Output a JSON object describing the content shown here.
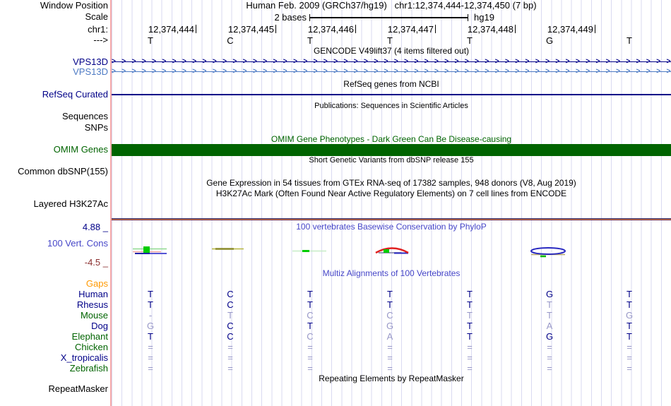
{
  "colors": {
    "navy": "#000088",
    "gene_blue": "#4d7ac4",
    "green": "#006400",
    "orange": "#ff9900",
    "title_blue": "#4646c8",
    "maroon": "#8b3030",
    "grid": "#dadaf2",
    "guide_pink": "#f5a9a9",
    "omim_green": "#006400",
    "base_dark": "#000088",
    "base_light": "#9898c8"
  },
  "header": {
    "title_left": "Human Feb. 2009 (GRCh37/hg19)",
    "title_right": "chr1:12,374,444-12,374,450 (7 bp)",
    "scale_bar": {
      "label": "2 bases",
      "assembly": "hg19"
    },
    "ruler": [
      "12,374,444",
      "12,374,445",
      "12,374,446",
      "12,374,447",
      "12,374,448",
      "12,374,449"
    ],
    "sequence": [
      "T",
      "C",
      "T",
      "T",
      "T",
      "G",
      "T"
    ]
  },
  "labels": {
    "window_position": "Window Position",
    "scale": "Scale",
    "chrom": "chr1:",
    "strand": "--->"
  },
  "tracks": {
    "gencode": {
      "title": "GENCODE V49lift37 (4 items filtered out)",
      "genes": [
        {
          "name": "VPS13D"
        },
        {
          "name": "VPS13D"
        }
      ]
    },
    "refseq": {
      "title": "RefSeq genes from NCBI",
      "label": "RefSeq Curated"
    },
    "publications": {
      "title": "Publications: Sequences in Scientific Articles"
    },
    "sequences": {
      "label": "Sequences"
    },
    "snps": {
      "label": "SNPs"
    },
    "omim": {
      "title": "OMIM Gene Phenotypes - Dark Green Can Be Disease-causing",
      "label": "OMIM Genes"
    },
    "dbsnp": {
      "title": "Short Genetic Variants from dbSNP release 155",
      "label": "Common dbSNP(155)"
    },
    "gtex": {
      "title": "Gene Expression in 54 tissues from GTEx RNA-seq of 17382 samples, 948 donors (V8, Aug 2019)"
    },
    "h3k27ac": {
      "title": "H3K27Ac Mark (Often Found Near Active Regulatory Elements) on 7 cell lines from ENCODE",
      "label": "Layered H3K27Ac"
    },
    "conservation": {
      "title": "100 vertebrates Basewise Conservation by PhyloP",
      "label": "100 Vert. Cons",
      "max": "4.88 _",
      "min": "-4.5 _"
    },
    "multiz": {
      "title": "Multiz Alignments of 100 Vertebrates"
    },
    "repeatmasker": {
      "title": "Repeating Elements by RepeatMasker",
      "label": "RepeatMasker"
    }
  },
  "alignment": {
    "species": [
      {
        "label": "Gaps",
        "color": "#ff9900",
        "bases": []
      },
      {
        "label": "Human",
        "color": "#000088",
        "bases": [
          [
            "T",
            "d"
          ],
          [
            "C",
            "d"
          ],
          [
            "T",
            "d"
          ],
          [
            "T",
            "d"
          ],
          [
            "T",
            "d"
          ],
          [
            "G",
            "d"
          ],
          [
            "T",
            "d"
          ]
        ]
      },
      {
        "label": "Rhesus",
        "color": "#000088",
        "bases": [
          [
            "T",
            "d"
          ],
          [
            "C",
            "d"
          ],
          [
            "T",
            "d"
          ],
          [
            "T",
            "d"
          ],
          [
            "T",
            "d"
          ],
          [
            "T",
            "l"
          ],
          [
            "T",
            "d"
          ]
        ]
      },
      {
        "label": "Mouse",
        "color": "#006400",
        "bases": [
          [
            "-",
            "l"
          ],
          [
            "T",
            "l"
          ],
          [
            "C",
            "l"
          ],
          [
            "C",
            "l"
          ],
          [
            "T",
            "l"
          ],
          [
            "T",
            "l"
          ],
          [
            "G",
            "l"
          ]
        ]
      },
      {
        "label": "Dog",
        "color": "#000088",
        "bases": [
          [
            "G",
            "l"
          ],
          [
            "C",
            "d"
          ],
          [
            "T",
            "d"
          ],
          [
            "G",
            "l"
          ],
          [
            "T",
            "d"
          ],
          [
            "A",
            "l"
          ],
          [
            "T",
            "d"
          ]
        ]
      },
      {
        "label": "Elephant",
        "color": "#006400",
        "bases": [
          [
            "T",
            "d"
          ],
          [
            "C",
            "d"
          ],
          [
            "C",
            "l"
          ],
          [
            "A",
            "l"
          ],
          [
            "T",
            "d"
          ],
          [
            "G",
            "d"
          ],
          [
            "T",
            "d"
          ]
        ]
      },
      {
        "label": "Chicken",
        "color": "#006400",
        "bases": [
          [
            "=",
            "l"
          ],
          [
            "=",
            "l"
          ],
          [
            "=",
            "l"
          ],
          [
            "=",
            "l"
          ],
          [
            "=",
            "l"
          ],
          [
            "=",
            "l"
          ],
          [
            "=",
            "l"
          ]
        ]
      },
      {
        "label": "X_tropicalis",
        "color": "#000088",
        "bases": [
          [
            "=",
            "l"
          ],
          [
            "=",
            "l"
          ],
          [
            "=",
            "l"
          ],
          [
            "=",
            "l"
          ],
          [
            "=",
            "l"
          ],
          [
            "=",
            "l"
          ],
          [
            "=",
            "l"
          ]
        ]
      },
      {
        "label": "Zebrafish",
        "color": "#006400",
        "bases": [
          [
            "=",
            "l"
          ],
          [
            "=",
            "l"
          ],
          [
            "=",
            "l"
          ],
          [
            "=",
            "l"
          ],
          [
            "=",
            "l"
          ],
          [
            "=",
            "l"
          ],
          [
            "=",
            "l"
          ]
        ]
      }
    ]
  }
}
